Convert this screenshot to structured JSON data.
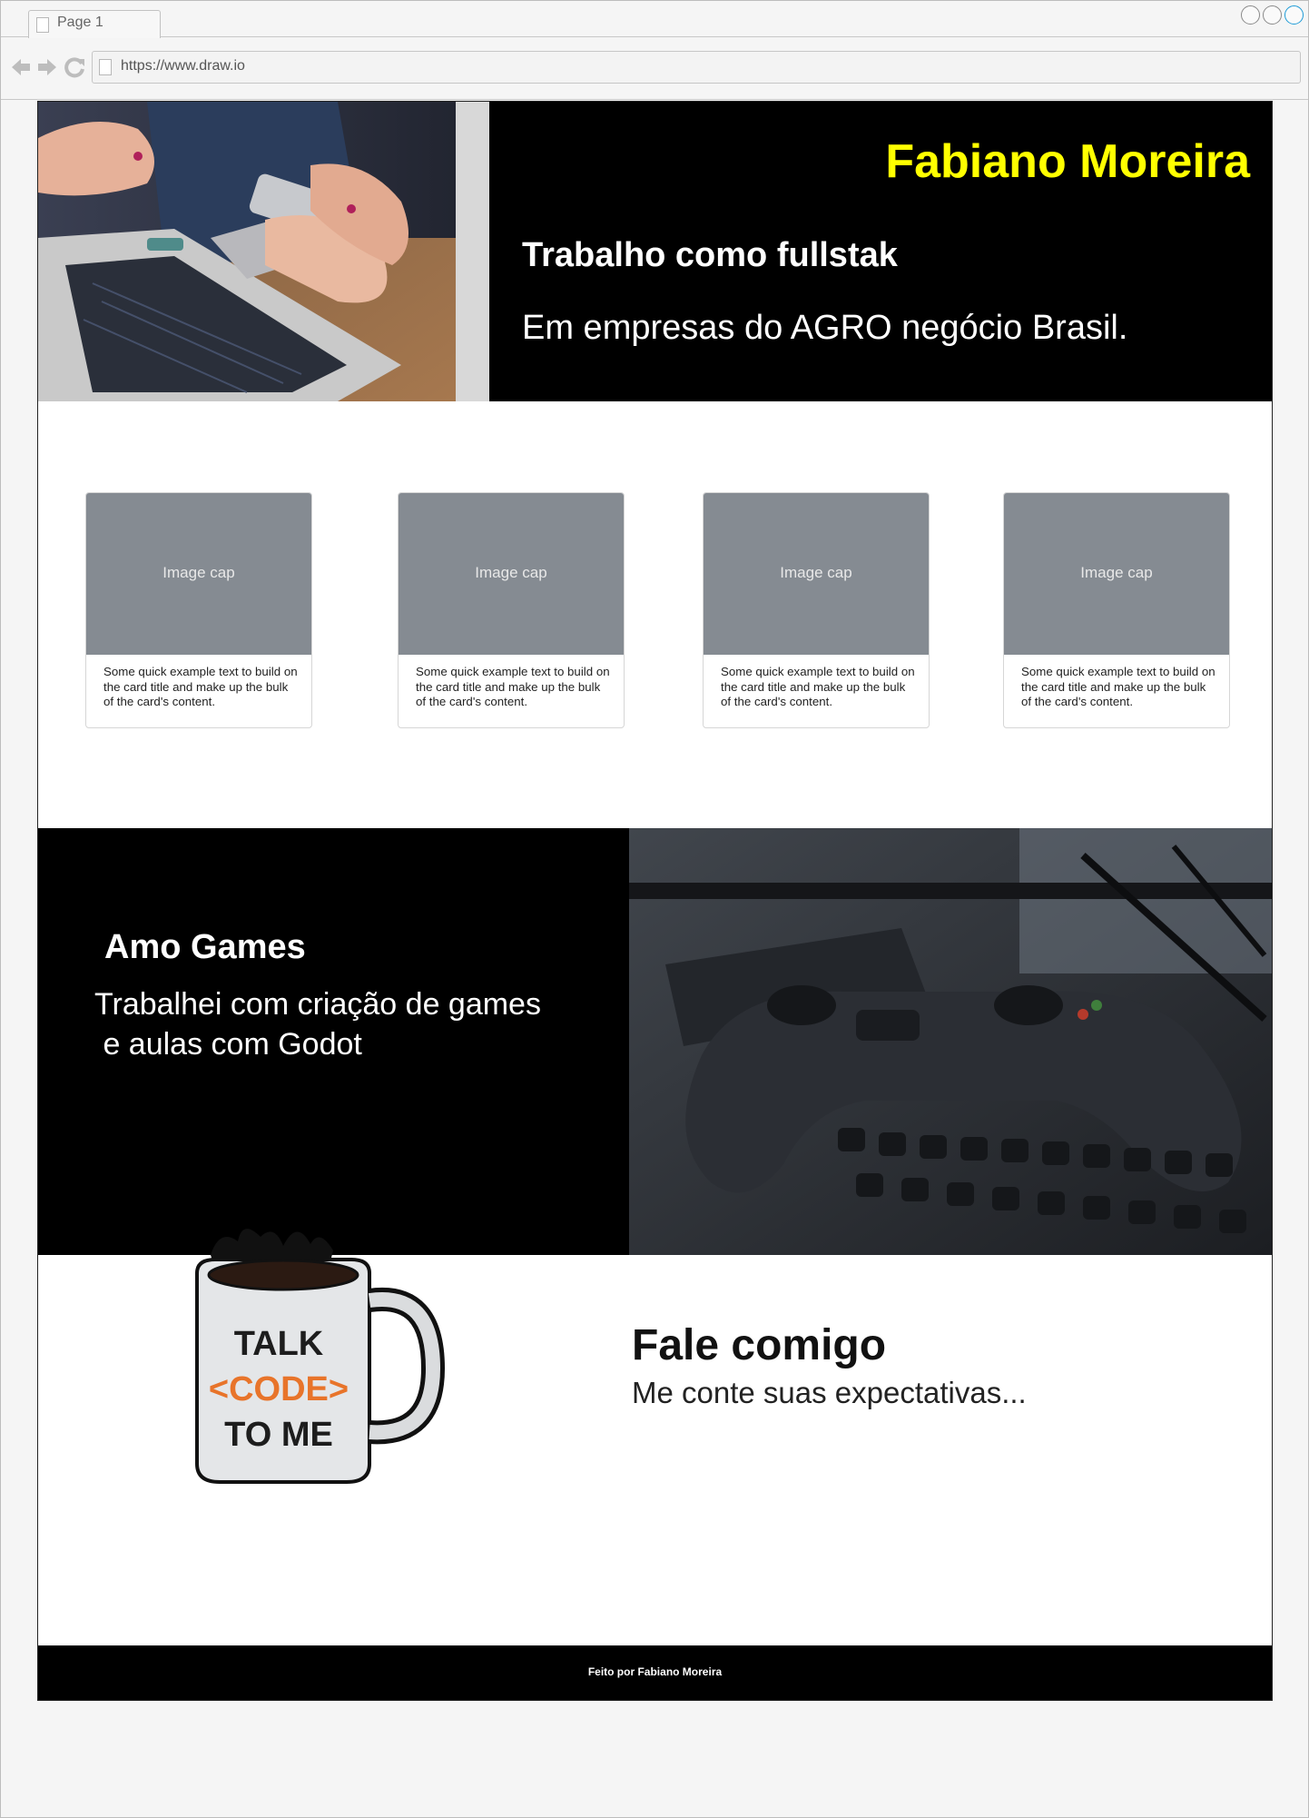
{
  "browser": {
    "tab_label": "Page 1",
    "url": "https://www.draw.io",
    "nav_icons": [
      "back-arrow-icon",
      "forward-arrow-icon",
      "reload-icon"
    ],
    "window_controls": [
      "circle",
      "circle",
      "circle"
    ]
  },
  "hero": {
    "name": "Fabiano Moreira",
    "title": "Trabalho como fullstak",
    "subtitle": "Em empresas do AGRO negócio Brasil.",
    "name_color": "#ffff00",
    "background": "#000000"
  },
  "cards": [
    {
      "cap": "Image cap",
      "text": "Some quick example text to build on the card title and make up the bulk of the card's content."
    },
    {
      "cap": "Image cap",
      "text": "Some quick example text to build on the card title and make up the bulk of the card's content."
    },
    {
      "cap": "Image cap",
      "text": "Some quick example text to build on the card title and make up the bulk of the card's content."
    },
    {
      "cap": "Image cap",
      "text": "Some quick example text to build on the card title and make up the bulk of the card's content."
    }
  ],
  "games": {
    "title": "Amo Games",
    "text": "Trabalhei com criação de games\n e aulas com Godot"
  },
  "contact": {
    "mug_line1": "TALK",
    "mug_line2": "<CODE>",
    "mug_line3": "TO ME",
    "mug_accent": "#e8742a",
    "title": "Fale comigo",
    "subtitle": "Me conte suas expectativas..."
  },
  "footer": {
    "text": "Feito por Fabiano Moreira"
  }
}
